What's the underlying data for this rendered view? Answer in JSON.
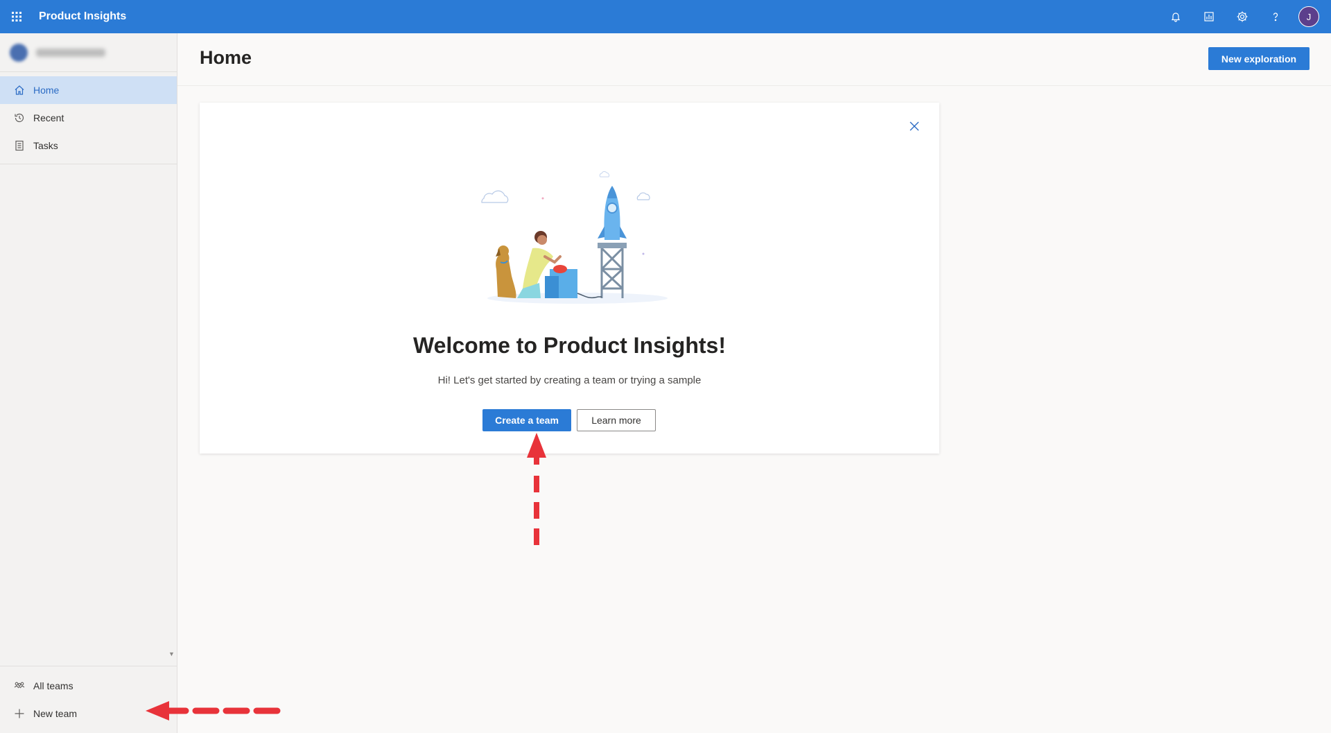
{
  "app": {
    "title": "Product Insights"
  },
  "topbar": {
    "icons": [
      "bell-icon",
      "chart-icon",
      "gear-icon",
      "help-icon"
    ],
    "avatar_initial": "J"
  },
  "sidebar": {
    "org_name_blurred": true,
    "items": [
      {
        "label": "Home",
        "icon": "home-icon",
        "active": true
      },
      {
        "label": "Recent",
        "icon": "history-icon",
        "active": false
      },
      {
        "label": "Tasks",
        "icon": "tasks-icon",
        "active": false
      }
    ],
    "bottom": [
      {
        "label": "All teams",
        "icon": "teams-icon"
      },
      {
        "label": "New team",
        "icon": "plus-icon"
      }
    ]
  },
  "header": {
    "title": "Home",
    "new_exploration_label": "New exploration"
  },
  "welcome": {
    "heading": "Welcome to Product Insights!",
    "subtitle": "Hi! Let's get started by creating a team or trying a sample",
    "create_label": "Create a team",
    "learn_label": "Learn more"
  },
  "colors": {
    "brand": "#2b7bd6",
    "annotation": "#e8333a"
  }
}
